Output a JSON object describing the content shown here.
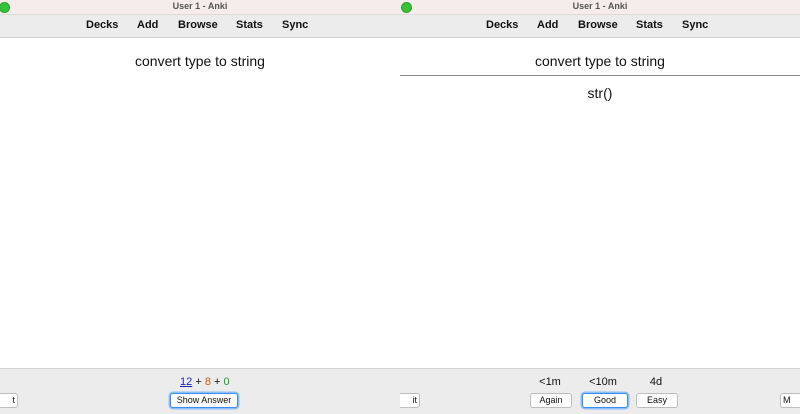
{
  "window": {
    "title": "User 1 - Anki"
  },
  "toolbar": {
    "decks": "Decks",
    "add": "Add",
    "browse": "Browse",
    "stats": "Stats",
    "sync": "Sync"
  },
  "card": {
    "question": "convert type to string",
    "answer": "str()"
  },
  "left_bottom": {
    "edit_label": "t",
    "counts": {
      "new": "12",
      "learning": "8",
      "review": "0",
      "plus": "+"
    },
    "show_answer_label": "Show Answer"
  },
  "right_bottom": {
    "edit_label": "it",
    "more_label": "M",
    "intervals": {
      "again": "<1m",
      "good": "<10m",
      "easy": "4d"
    },
    "buttons": {
      "again": "Again",
      "good": "Good",
      "easy": "Easy"
    }
  },
  "colors": {
    "new": "#1d1dbb",
    "learning": "#c25a12",
    "review": "#1f9a2a",
    "focus": "#3b8ef0",
    "traffic_light": "#37c23a"
  }
}
